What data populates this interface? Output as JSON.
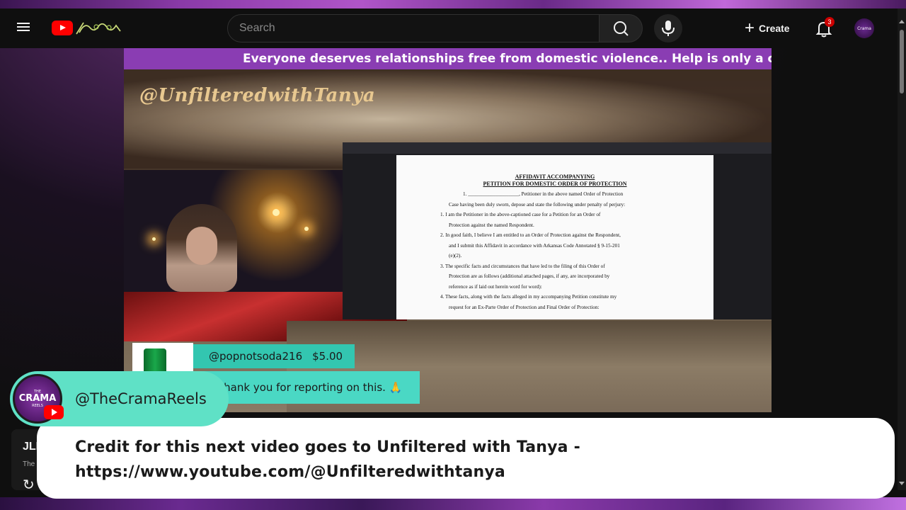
{
  "header": {
    "search_placeholder": "Search",
    "create_label": "Create",
    "notification_count": "3",
    "avatar_text": "Crama"
  },
  "video": {
    "banner_text": "Everyone deserves relationships free from domestic violence.. Help is only a call away! ♡",
    "streamer_handle": "@UnfilteredwithTanya",
    "doc_title_line1": "AFFIDAVIT ACCOMPANYING",
    "doc_title_line2": "PETITION FOR DOMESTIC ORDER OF PROTECTION",
    "doc_lines": [
      "1. ____________________, Petitioner in the above named Order of Protection",
      "Case having been duly sworn, depose and state the following under penalty of perjury:",
      "1.  I am the Petitioner in the above-captioned case for a Petition for an Order of",
      "Protection against the named Respondent.",
      "2.  In good faith, I believe I am entitled to an Order of Protection against the Respondent,",
      "and I submit this Affidavit in accordance with Arkansas Code Annotated § 9-15-201",
      "(e)(2).",
      "3.  The specific facts and circumstances that have led to the filing of this Order of",
      "Protection are as follows (additional attached pages, if any, are incorporated by",
      "reference as if laid out herein word for word):",
      "4.  These facts, along with the facts alleged in my accompanying Petition constitute my",
      "request for an Ex-Parte Order of Protection and Final Order of Protection:"
    ],
    "donation_user": "@popnotsoda216",
    "donation_amount": "$5.00",
    "donation_message": "Thank you for reporting on this. 🙏"
  },
  "below_video": {
    "title": "JLI",
    "subtitle": "The"
  },
  "overlay": {
    "channel_handle": "@TheCramaReels",
    "avatar_line1": "THE",
    "avatar_line2": "CRAMA",
    "avatar_line3": "REELS",
    "credit_line1": "Credit for this next video goes to Unfiltered with Tanya -",
    "credit_line2": "https://www.youtube.com/@Unfilteredwithtanya"
  },
  "colors": {
    "youtube_red": "#ff0000",
    "banner_purple": "#8a3db3",
    "handle_card_teal": "#5fe1c6",
    "donation_teal": "#33c6b0"
  }
}
